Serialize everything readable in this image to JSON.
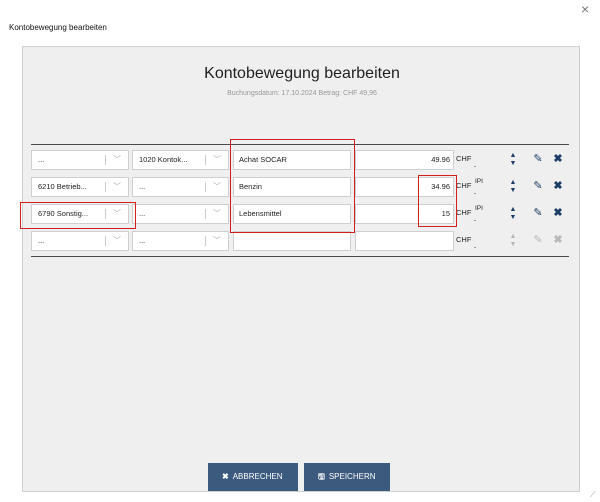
{
  "window": {
    "title": "Kontobewegung bearbeiten",
    "close_glyph": "×"
  },
  "panel": {
    "heading": "Kontobewegung bearbeiten",
    "subheading": "Buchungsdatum: 17.10.2024   Betrag: CHF 49,96"
  },
  "rows": [
    {
      "debit": "...",
      "credit": "1020 Kontok...",
      "text": "Achat SOCAR",
      "amount": "49.96",
      "currency": "CHF",
      "superscript": "",
      "active": true
    },
    {
      "debit": "6210 Betrieb...",
      "credit": "...",
      "text": "Benzin",
      "amount": "34.96",
      "currency": "CHF",
      "superscript": "IPI",
      "active": true
    },
    {
      "debit": "6790 Sonstig...",
      "credit": "...",
      "text": "Lebensmittel",
      "amount": "15",
      "currency": "CHF",
      "superscript": "IPI",
      "active": true
    },
    {
      "debit": "...",
      "credit": "...",
      "text": "",
      "amount": "",
      "currency": "CHF",
      "superscript": "",
      "active": false
    }
  ],
  "buttons": {
    "cancel": "ABBRECHEN",
    "save": "SPEICHERN"
  },
  "icons": {
    "edit": "edit-icon",
    "delete": "delete-icon",
    "chevron": "chevron-down-icon",
    "spinner": "spinner-icon"
  },
  "colors": {
    "accent": "#3b5a7e",
    "highlight": "#d21d1d",
    "panel_bg": "#efefef"
  }
}
